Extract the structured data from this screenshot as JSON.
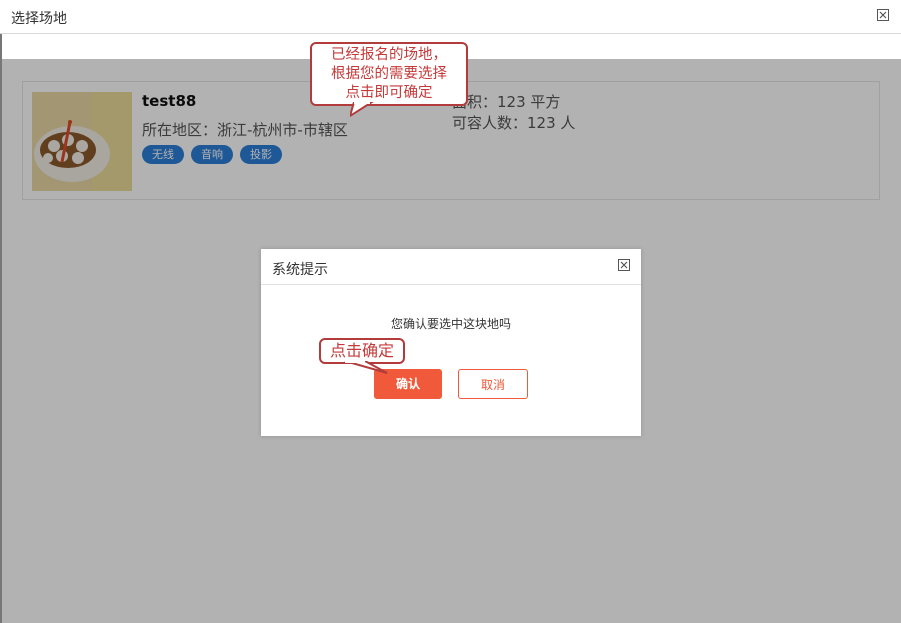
{
  "window": {
    "title": "选择场地"
  },
  "venue": {
    "name": "test88",
    "region": "所在地区：浙江-杭州市-市辖区",
    "tags": [
      "无线",
      "音响",
      "投影"
    ],
    "area": "面积：123 平方",
    "capacity": "可容人数：123 人"
  },
  "callouts": {
    "venue_hint_lines": [
      "已经报名的场地，",
      "根据您的需要选择",
      "点击即可确定"
    ],
    "confirm_hint": "点击确定"
  },
  "dialog": {
    "title": "系统提示",
    "message": "您确认要选中这块地吗",
    "confirm_label": "确认",
    "cancel_label": "取消"
  },
  "colors": {
    "tag_blue": "#2c7fd9",
    "confirm_orange": "#f0593a",
    "callout_red": "#b23b3b"
  },
  "icons": {
    "close": "close-icon"
  }
}
